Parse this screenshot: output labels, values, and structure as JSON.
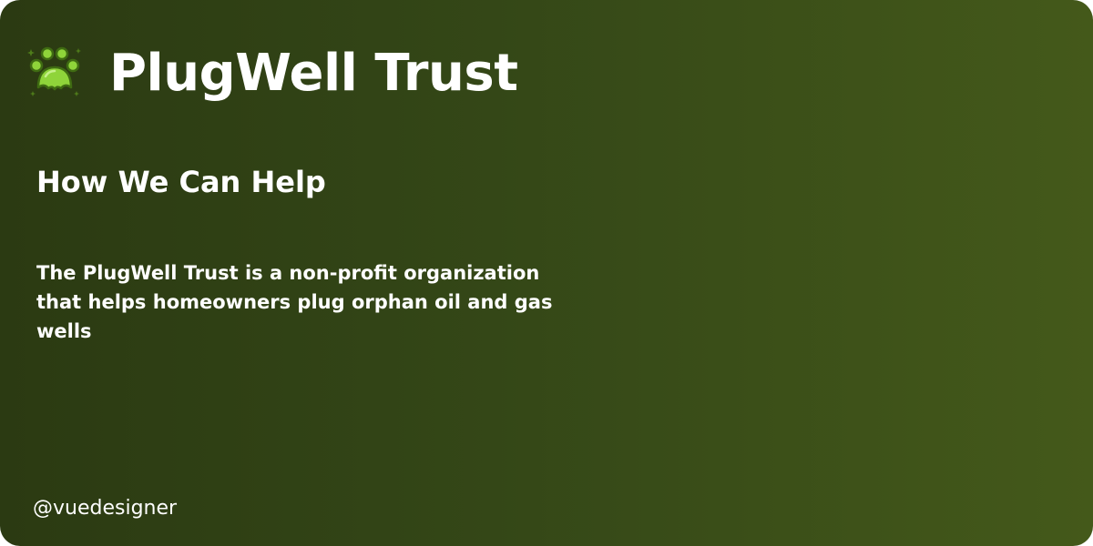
{
  "brand": {
    "name": "PlugWell Trust",
    "logo_icon": "paw-icon",
    "logo_color": "#8fd43a"
  },
  "main": {
    "heading": "How We Can Help",
    "description": "The PlugWell Trust is a non-profit organization that helps homeowners plug orphan oil and gas wells"
  },
  "footer": {
    "handle": "@vuedesigner"
  },
  "colors": {
    "background_start": "#2b3a12",
    "background_end": "#44591a",
    "text": "#ffffff"
  }
}
